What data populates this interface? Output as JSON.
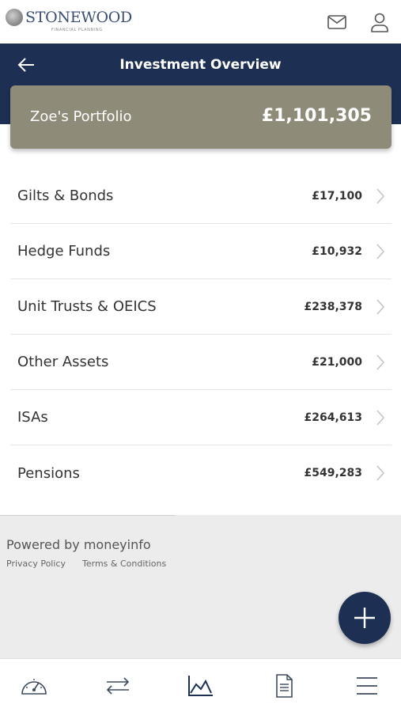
{
  "brand": {
    "name": "STONEWOOD",
    "tagline": "FINANCIAL PLANNING"
  },
  "header": {
    "title": "Investment Overview"
  },
  "portfolio": {
    "name": "Zoe's Portfolio",
    "total": "£1,101,305"
  },
  "assets": [
    {
      "label": "Gilts & Bonds",
      "value": "£17,100"
    },
    {
      "label": "Hedge Funds",
      "value": "£10,932"
    },
    {
      "label": "Unit Trusts & OEICS",
      "value": "£238,378"
    },
    {
      "label": "Other Assets",
      "value": "£21,000"
    },
    {
      "label": "ISAs",
      "value": "£264,613"
    },
    {
      "label": "Pensions",
      "value": "£549,283"
    }
  ],
  "footer": {
    "powered_by": "Powered by moneyinfo",
    "privacy": "Privacy Policy",
    "terms": "Terms & Conditions"
  },
  "tabs": [
    {
      "icon": "dashboard-gauge-icon"
    },
    {
      "icon": "transfer-arrows-icon"
    },
    {
      "icon": "area-chart-icon",
      "active": true
    },
    {
      "icon": "document-icon"
    },
    {
      "icon": "menu-icon"
    }
  ],
  "colors": {
    "navy": "#1d3054",
    "card": "#8f8b79",
    "footer_bg": "#ececec"
  }
}
